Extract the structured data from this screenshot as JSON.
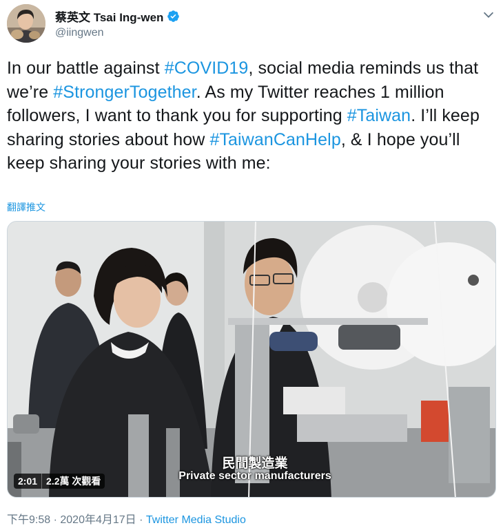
{
  "author": {
    "display_name": "蔡英文 Tsai Ing-wen",
    "handle": "@iingwen",
    "verified": true
  },
  "tweet": {
    "segments": [
      {
        "text": "In our battle against ",
        "hashtag": false
      },
      {
        "text": "#COVID19",
        "hashtag": true
      },
      {
        "text": ", social media reminds us that we’re ",
        "hashtag": false
      },
      {
        "text": "#StrongerTogether",
        "hashtag": true
      },
      {
        "text": ". As my Twitter reaches 1 million followers, I want to thank you for supporting ",
        "hashtag": false
      },
      {
        "text": "#Taiwan",
        "hashtag": true
      },
      {
        "text": ". I’ll keep sharing stories about how ",
        "hashtag": false
      },
      {
        "text": "#TaiwanCanHelp",
        "hashtag": true
      },
      {
        "text": ", & I hope you’ll keep sharing your stories with me:",
        "hashtag": false
      }
    ],
    "translate_label": "翻譯推文"
  },
  "video": {
    "duration": "2:01",
    "views": "2.2萬 次觀看",
    "subtitle_zh": "民間製造業",
    "subtitle_en": "Private sector manufacturers"
  },
  "meta": {
    "time": "下午9:58",
    "separator": " · ",
    "date": "2020年4月17日",
    "source": "Twitter Media Studio"
  },
  "colors": {
    "accent": "#1b95e0",
    "text": "#14171a",
    "secondary": "#657786",
    "verified": "#1da1f2"
  },
  "icons": {
    "verified": "verified-badge-icon",
    "caret": "chevron-down-icon"
  }
}
